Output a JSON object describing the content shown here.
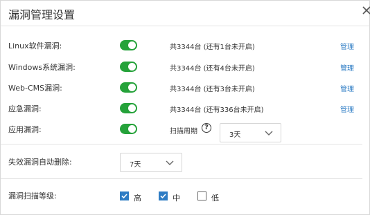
{
  "dialog": {
    "title": "漏洞管理设置",
    "close_icon": "close-icon"
  },
  "vuln_rows": [
    {
      "label": "Linux软件漏洞:",
      "enabled": true,
      "count_text": "共3344台 (还有1台未开启)",
      "manage_label": "管理"
    },
    {
      "label": "Windows系统漏洞:",
      "enabled": true,
      "count_text": "共3344台 (还有4台未开启)",
      "manage_label": "管理"
    },
    {
      "label": "Web-CMS漏洞:",
      "enabled": true,
      "count_text": "共3344台 (还有3台未开启)",
      "manage_label": "管理"
    },
    {
      "label": "应急漏洞:",
      "enabled": true,
      "count_text": "共3344台 (还有336台未开启)",
      "manage_label": "管理"
    },
    {
      "label": "应用漏洞:",
      "enabled": true
    }
  ],
  "scan_period": {
    "label": "扫描周期",
    "help_icon": "question-circle-icon",
    "value": "3天"
  },
  "auto_delete": {
    "label": "失效漏洞自动删除:",
    "value": "7天"
  },
  "scan_level": {
    "label": "漏洞扫描等级:",
    "options": [
      {
        "label": "高",
        "checked": true
      },
      {
        "label": "中",
        "checked": true
      },
      {
        "label": "低",
        "checked": false
      }
    ]
  },
  "colors": {
    "toggle_on": "#25a23a",
    "link": "#2e7cc4",
    "checkbox_checked": "#2e7cc4"
  }
}
